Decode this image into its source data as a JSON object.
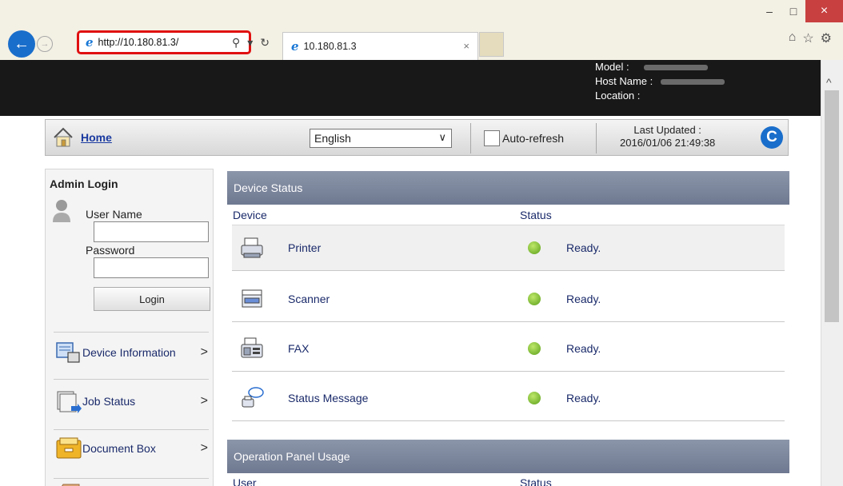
{
  "browser": {
    "address": "http://10.180.81.3/",
    "tab_title": "10.180.81.3",
    "tab_close": "×",
    "win_minimize": "–",
    "win_maximize": "□",
    "win_close": "×"
  },
  "header": {
    "model_label": "Model :",
    "host_label": "Host Name :",
    "location_label": "Location :"
  },
  "topbar": {
    "home_label": "Home",
    "language": "English",
    "auto_refresh_label": "Auto-refresh",
    "last_updated_label": "Last Updated :",
    "last_updated_value": "2016/01/06 21:49:38"
  },
  "sidebar": {
    "admin_title": "Admin Login",
    "username_label": "User Name",
    "password_label": "Password",
    "login_label": "Login",
    "items": [
      {
        "label": "Device Information",
        "icon": "device-information-icon"
      },
      {
        "label": "Job Status",
        "icon": "job-status-icon"
      },
      {
        "label": "Document Box",
        "icon": "document-box-icon"
      }
    ]
  },
  "device_status": {
    "title": "Device Status",
    "col_device": "Device",
    "col_status": "Status",
    "rows": [
      {
        "device": "Printer",
        "status": "Ready.",
        "icon": "printer-icon"
      },
      {
        "device": "Scanner",
        "status": "Ready.",
        "icon": "scanner-icon"
      },
      {
        "device": "FAX",
        "status": "Ready.",
        "icon": "fax-icon"
      },
      {
        "device": "Status Message",
        "status": "Ready.",
        "icon": "status-message-icon"
      }
    ]
  },
  "operation_panel": {
    "title": "Operation Panel Usage",
    "col_user": "User",
    "col_status": "Status"
  },
  "colors": {
    "highlight": "#e01010",
    "link": "#1a3aa0",
    "panel_header": "#7a8498",
    "status_ok": "#6ab42a"
  }
}
